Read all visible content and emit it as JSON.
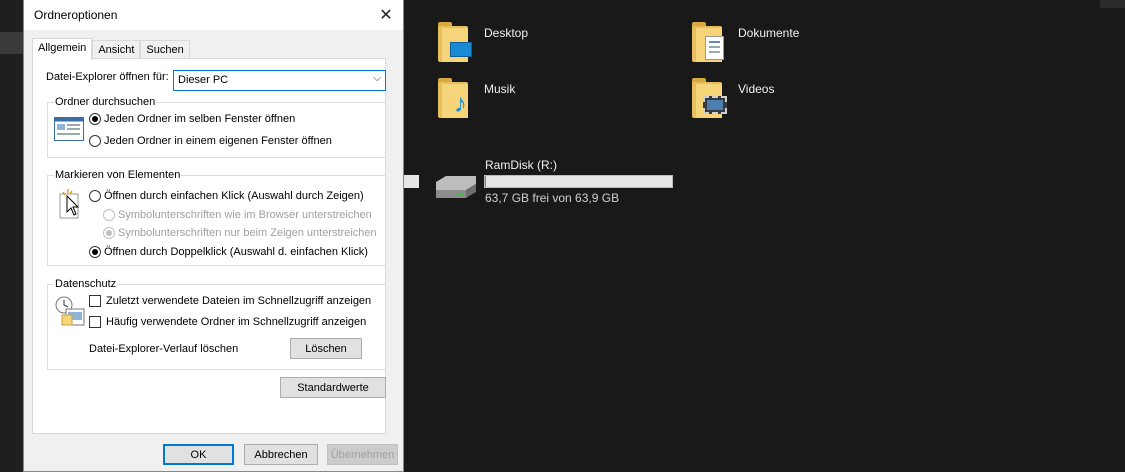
{
  "dialog": {
    "title": "Ordneroptionen",
    "close_glyph": "✕",
    "tabs": [
      {
        "label": "Allgemein",
        "active": true
      },
      {
        "label": "Ansicht",
        "active": false
      },
      {
        "label": "Suchen",
        "active": false
      }
    ],
    "open_label": "Datei-Explorer öffnen für:",
    "open_value": "Dieser PC",
    "browse": {
      "title": "Ordner durchsuchen",
      "opt1": "Jeden Ordner im selben Fenster öffnen",
      "opt2": "Jeden Ordner in einem eigenen Fenster öffnen"
    },
    "click": {
      "title": "Markieren von Elementen",
      "opt1": "Öffnen durch einfachen Klick (Auswahl durch Zeigen)",
      "sub1": "Symbolunterschriften wie im Browser unterstreichen",
      "sub2": "Symbolunterschriften nur beim Zeigen unterstreichen",
      "opt2": "Öffnen durch Doppelklick (Auswahl d. einfachen Klick)"
    },
    "privacy": {
      "title": "Datenschutz",
      "check1": "Zuletzt verwendete Dateien im Schnellzugriff anzeigen",
      "check2": "Häufig verwendete Ordner im Schnellzugriff anzeigen",
      "clear_label": "Datei-Explorer-Verlauf löschen",
      "clear_button": "Löschen"
    },
    "defaults_button": "Standardwerte",
    "ok": "OK",
    "cancel": "Abbrechen",
    "apply": "Übernehmen"
  },
  "explorer": {
    "folders": [
      {
        "name": "Desktop",
        "icon": "desktop-folder-icon"
      },
      {
        "name": "Dokumente",
        "icon": "documents-folder-icon"
      },
      {
        "name": "Musik",
        "icon": "music-folder-icon"
      },
      {
        "name": "Videos",
        "icon": "videos-folder-icon"
      }
    ],
    "drive": {
      "name": "RamDisk (R:)",
      "free_text": "63,7 GB frei von 63,9 GB",
      "used_fraction": 0.003
    }
  }
}
